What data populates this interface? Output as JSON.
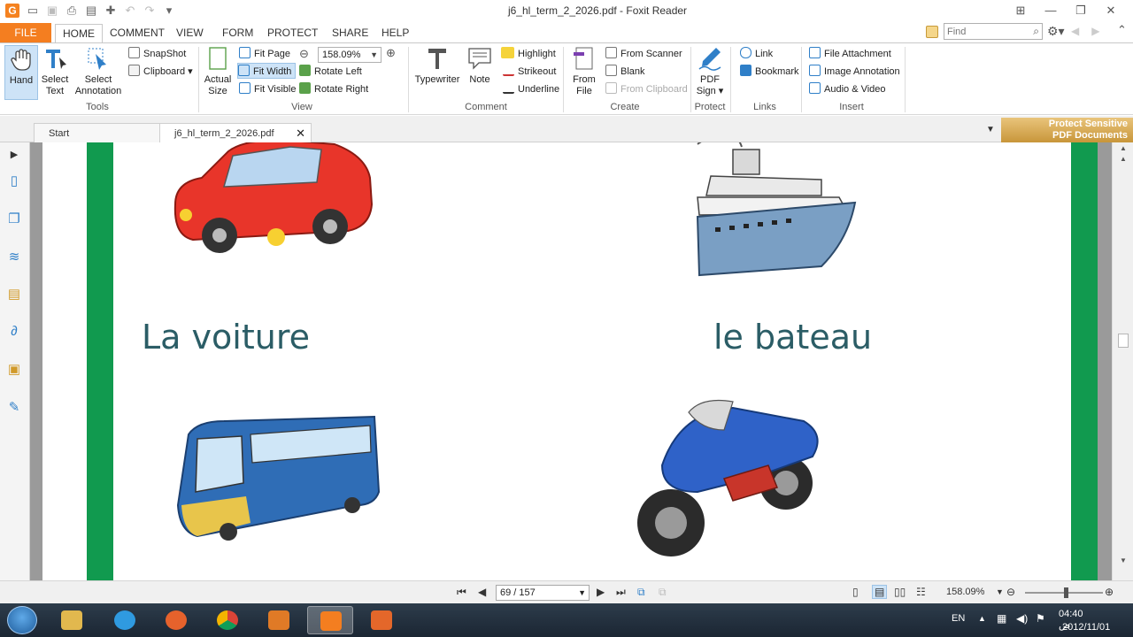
{
  "window": {
    "title": "j6_hl_term_2_2026.pdf - Foxit Reader"
  },
  "ribbon_tabs": [
    "FILE",
    "HOME",
    "COMMENT",
    "VIEW",
    "FORM",
    "PROTECT",
    "SHARE",
    "HELP"
  ],
  "find": {
    "placeholder": "Find"
  },
  "ribbon": {
    "tools": {
      "label": "Tools",
      "hand": "Hand",
      "select_text": [
        "Select",
        "Text"
      ],
      "select_annotation": [
        "Select",
        "Annotation"
      ],
      "snapshot": "SnapShot",
      "clipboard": "Clipboard"
    },
    "view": {
      "label": "View",
      "actual_size": [
        "Actual",
        "Size"
      ],
      "fit_page": "Fit Page",
      "fit_width": "Fit Width",
      "fit_visible": "Fit Visible",
      "zoom_value": "158.09%",
      "rotate_left": "Rotate Left",
      "rotate_right": "Rotate Right"
    },
    "comment": {
      "label": "Comment",
      "typewriter": "Typewriter",
      "note": "Note",
      "highlight": "Highlight",
      "strikeout": "Strikeout",
      "underline": "Underline"
    },
    "create": {
      "label": "Create",
      "from_file": [
        "From",
        "File"
      ],
      "from_scanner": "From Scanner",
      "blank": "Blank",
      "from_clipboard": "From Clipboard"
    },
    "protect": {
      "label": "Protect",
      "pdf_sign": [
        "PDF",
        "Sign"
      ]
    },
    "links": {
      "label": "Links",
      "link": "Link",
      "bookmark": "Bookmark"
    },
    "insert": {
      "label": "Insert",
      "file_attachment": "File Attachment",
      "image_annotation": "Image Annotation",
      "audio_video": "Audio & Video"
    }
  },
  "doc_tabs": {
    "start": "Start",
    "current": "j6_hl_term_2_2026.pdf"
  },
  "promo": [
    "Protect Sensitive",
    "PDF Documents"
  ],
  "page_content": {
    "word_car": "La voiture",
    "word_boat": "le bateau"
  },
  "status": {
    "page": "69 / 157",
    "zoom": "158.09%"
  },
  "tray": {
    "language": "EN",
    "time": "04:40 ص",
    "date": "2012/11/01"
  }
}
